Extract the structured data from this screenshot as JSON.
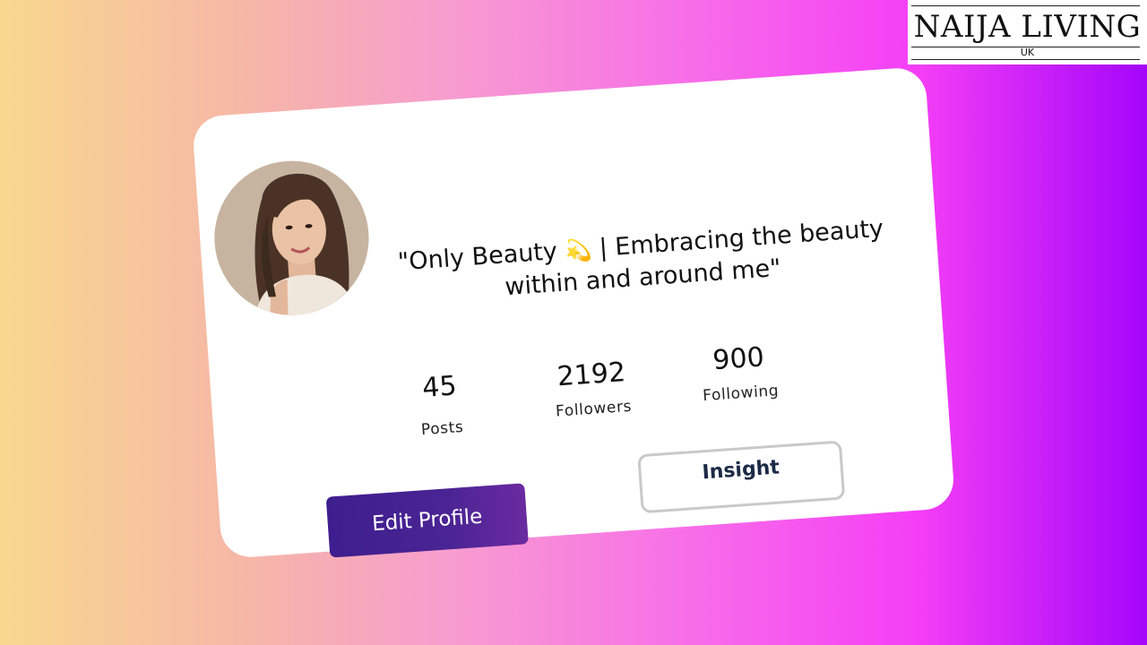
{
  "brand": {
    "name": "NAIJA LIVING",
    "subtitle": "UK"
  },
  "profile": {
    "avatar_icon": "profile-photo",
    "bio_part1": "\"Only Beauty ",
    "bio_emoji": "💫",
    "bio_part2": " | Embracing the beauty within and around me\""
  },
  "stats": {
    "posts": {
      "value": "45",
      "label": "Posts"
    },
    "followers": {
      "value": "2192",
      "label": "Followers"
    },
    "following": {
      "value": "900",
      "label": "Following"
    }
  },
  "actions": {
    "edit_profile_label": "Edit Profile",
    "insight_label": "Insight"
  },
  "colors": {
    "edit_button": "#3e1e8e",
    "insight_border": "#c9c9c9",
    "background_start": "#f8d88e",
    "background_end": "#a506fb"
  }
}
